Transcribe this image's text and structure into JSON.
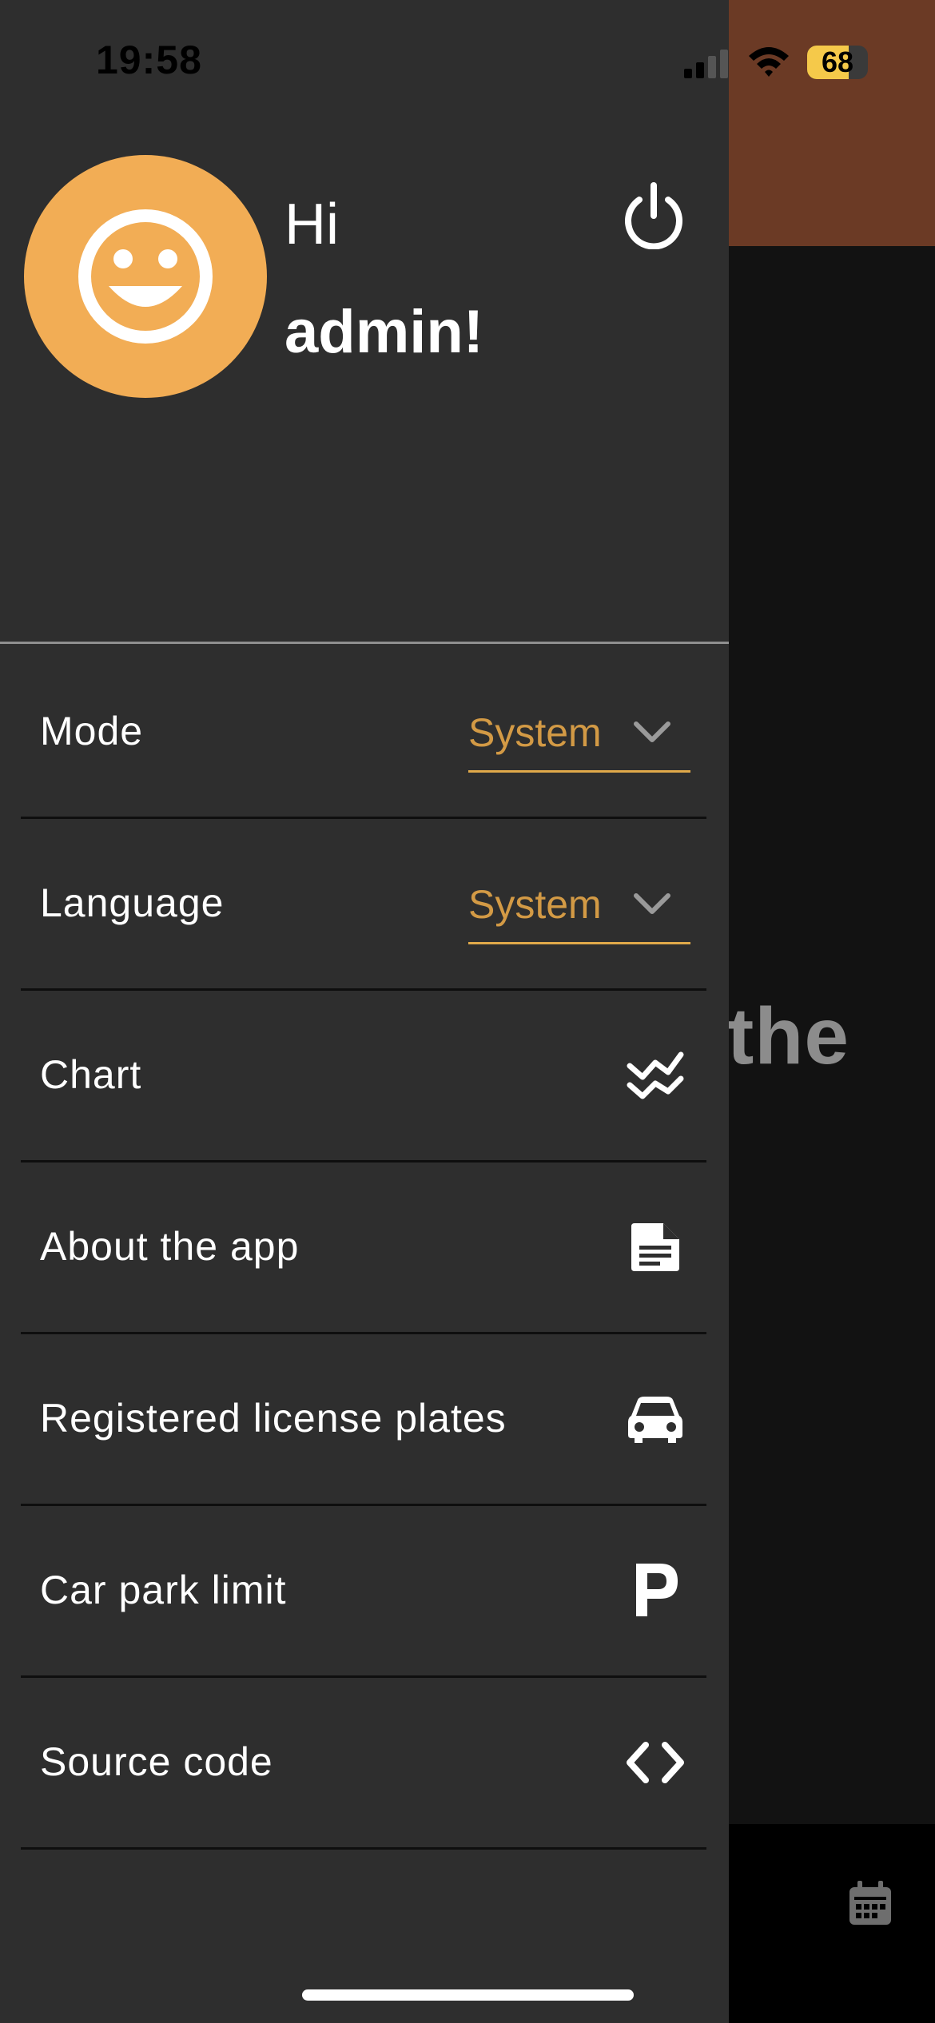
{
  "status_bar": {
    "time": "19:58",
    "battery": "68",
    "battery_color": "#f5c94a"
  },
  "background": {
    "visible_text": "the",
    "header_color": "#6b3a25",
    "bottom_icon": "calendar-icon"
  },
  "drawer": {
    "greeting": "Hi",
    "username": "admin!",
    "avatar_icon": "smiley-icon",
    "avatar_color": "#f2ad55",
    "power_icon": "power-icon"
  },
  "settings": {
    "mode": {
      "label": "Mode",
      "value": "System"
    },
    "language": {
      "label": "Language",
      "value": "System"
    }
  },
  "menu": {
    "items": [
      {
        "label": "Chart",
        "icon": "chart-icon"
      },
      {
        "label": "About the app",
        "icon": "document-icon"
      },
      {
        "label": "Registered license plates",
        "icon": "car-icon"
      },
      {
        "label": "Car park limit",
        "icon": "parking-icon"
      },
      {
        "label": "Source code",
        "icon": "code-icon"
      }
    ]
  },
  "accent_color": "#d39a45"
}
